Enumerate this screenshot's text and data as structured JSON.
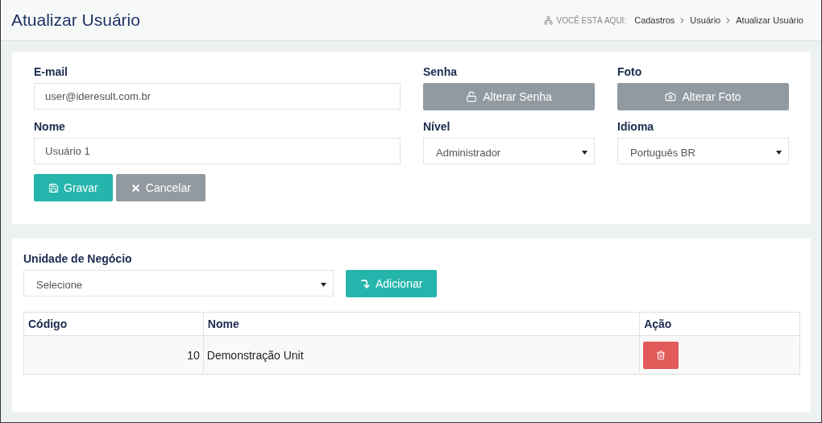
{
  "header": {
    "title": "Atualizar Usuário",
    "breadcrumb": {
      "label": "VOCÊ ESTÁ AQUI:",
      "items": [
        "Cadastros",
        "Usuário",
        "Atualizar Usuário"
      ]
    }
  },
  "user_form": {
    "email": {
      "label": "E-mail",
      "value": "user@ideresult.com.br"
    },
    "password": {
      "label": "Senha",
      "button": "Alterar Senha"
    },
    "photo": {
      "label": "Foto",
      "button": "Alterar Foto"
    },
    "name": {
      "label": "Nome",
      "value": "Usuário 1"
    },
    "level": {
      "label": "Nível",
      "value": "Administrador"
    },
    "language": {
      "label": "Idioma",
      "value": "Português BR"
    },
    "buttons": [
      {
        "kind": "save",
        "label": "Gravar"
      },
      {
        "kind": "cancel",
        "label": "Cancelar"
      }
    ]
  },
  "business_units": {
    "label": "Unidade de Negócio",
    "select": {
      "value": "Selecione"
    },
    "add_button": "Adicionar",
    "table": {
      "columns": [
        "Código",
        "Nome",
        "Ação"
      ],
      "rows": [
        {
          "code": "10",
          "name": "Demonstração Unit"
        }
      ]
    }
  }
}
